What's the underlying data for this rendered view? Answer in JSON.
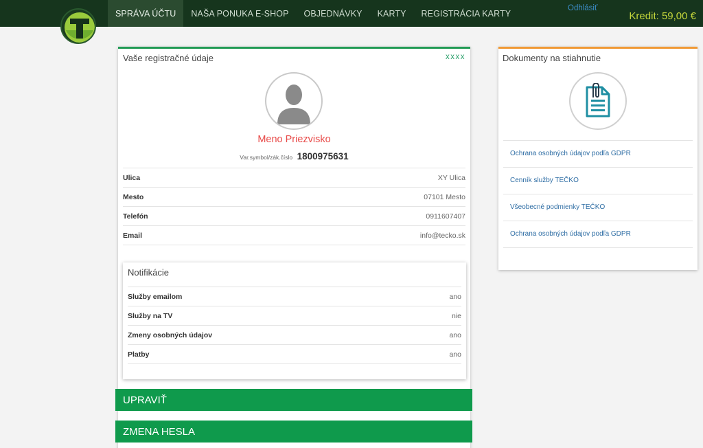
{
  "nav": {
    "items": [
      {
        "label": "SPRÁVA ÚČTU",
        "active": true
      },
      {
        "label": "NAŠA PONUKA E-SHOP",
        "active": false
      },
      {
        "label": "OBJEDNÁVKY",
        "active": false
      },
      {
        "label": "KARTY",
        "active": false
      },
      {
        "label": "REGISTRÁCIA KARTY",
        "active": false
      }
    ],
    "logout": "Odhlásiť",
    "credit": "Kredit: 59,00 €"
  },
  "profile": {
    "title": "Vaše registračné údaje",
    "id_text": "xxxx",
    "name": "Meno Priezvisko",
    "var_symbol_label": "Var.symbol/zák.číslo",
    "var_symbol_value": "1800975631",
    "fields": [
      {
        "label": "Ulica",
        "value": "XY Ulica"
      },
      {
        "label": "Mesto",
        "value": "07101 Mesto"
      },
      {
        "label": "Telefón",
        "value": "0911607407"
      },
      {
        "label": "Email",
        "value": "info@tecko.sk"
      }
    ]
  },
  "notifications": {
    "title": "Notifikácie",
    "items": [
      {
        "label": "Služby emailom",
        "value": "ano"
      },
      {
        "label": "Služby na TV",
        "value": "nie"
      },
      {
        "label": "Zmeny osobných údajov",
        "value": "ano"
      },
      {
        "label": "Platby",
        "value": "ano"
      }
    ]
  },
  "actions": {
    "edit": "UPRAVIŤ",
    "change_password": "ZMENA HESLA"
  },
  "documents": {
    "title": "Dokumenty na stiahnutie",
    "icon": "document-clip-icon",
    "items": [
      "Ochrana osobných údajov podľa GDPR",
      "Cenník služby TEČKO",
      "Všeobecné podmienky TEČKO",
      "Ochrana osobných údajov podľa GDPR"
    ]
  },
  "colors": {
    "topbar": "#16351d",
    "accent_green": "#0f9a4c",
    "name_red": "#e84a48",
    "link_blue": "#2e6da4",
    "credit_yellow": "#c4d63b",
    "docs_border": "#f09a36"
  }
}
